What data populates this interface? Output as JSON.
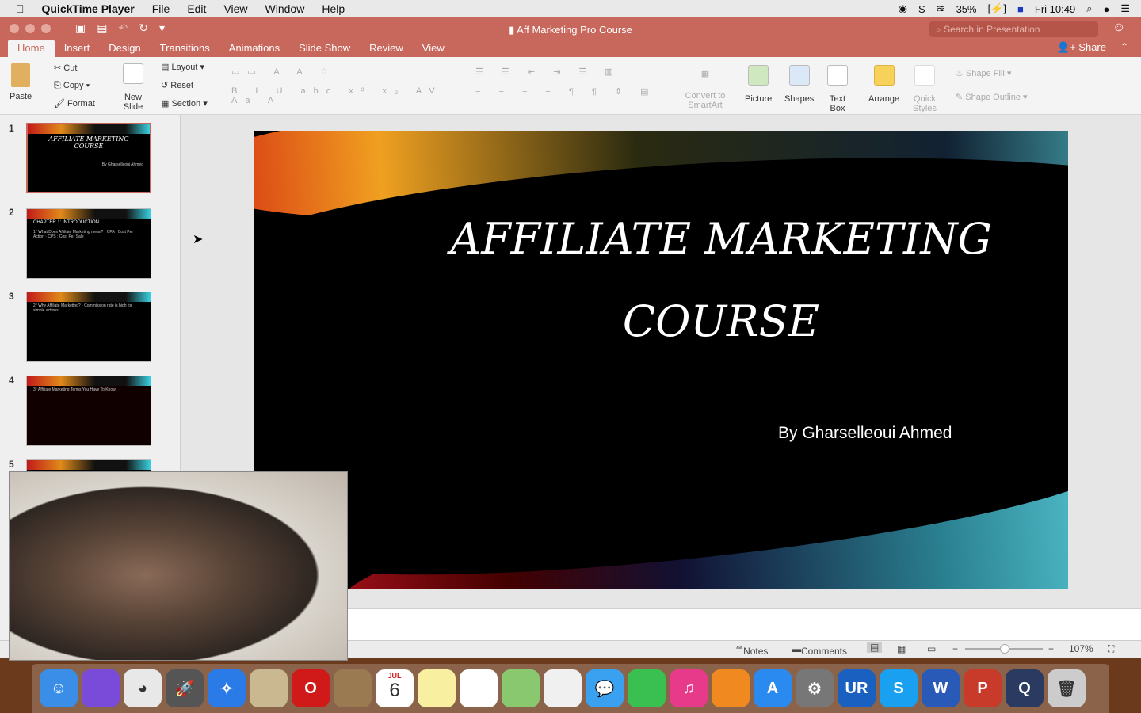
{
  "menubar": {
    "app": "QuickTime Player",
    "items": [
      "File",
      "Edit",
      "View",
      "Window",
      "Help"
    ],
    "battery": "35%",
    "clock": "Fri 10:49"
  },
  "window": {
    "title": "Aff Marketing Pro Course",
    "search_placeholder": "Search in Presentation",
    "share": "Share",
    "tabs": [
      "Home",
      "Insert",
      "Design",
      "Transitions",
      "Animations",
      "Slide Show",
      "Review",
      "View"
    ],
    "active_tab": "Home"
  },
  "ribbon": {
    "paste": "Paste",
    "cut": "Cut",
    "copy": "Copy",
    "format": "Format",
    "new_slide": "New Slide",
    "layout": "Layout",
    "reset": "Reset",
    "section": "Section",
    "convert": "Convert to SmartArt",
    "picture": "Picture",
    "shapes": "Shapes",
    "text_box": "Text Box",
    "arrange": "Arrange",
    "quick_styles": "Quick Styles",
    "shape_fill": "Shape Fill",
    "shape_outline": "Shape Outline"
  },
  "thumbnails": [
    {
      "num": "1",
      "title": "AFFILIATE MARKETING COURSE",
      "sub": "By Gharselleoui Ahmed"
    },
    {
      "num": "2",
      "title": "CHAPTER 1: INTRODUCTION",
      "sub": "1° What Does Affiliate Marketing mean? · CPA : Cost Per Action · CPS : Cost Per Sale"
    },
    {
      "num": "3",
      "title": "",
      "sub": "2° Why Affiliate Marketing? · Commission rate is high for simple actions."
    },
    {
      "num": "4",
      "title": "",
      "sub": "3° Affiliate Marketing Terms You Have To Know"
    },
    {
      "num": "5",
      "title": "",
      "sub": ""
    }
  ],
  "slide": {
    "title_line1": "AFFILIATE MARKETING",
    "title_line2": "COURSE",
    "author": "By Gharselleoui Ahmed"
  },
  "status": {
    "notes": "Notes",
    "comments": "Comments",
    "zoom": "107%",
    "zoom_fraction": 0.5
  },
  "dock": [
    "Finder",
    "Siri",
    "Chrome",
    "Launchpad",
    "Safari",
    "Mail",
    "Opera",
    "Notefile",
    "Calendar",
    "Notes",
    "Reminders",
    "Maps",
    "Photos",
    "Messages",
    "FaceTime",
    "iTunes",
    "iBooks",
    "App Store",
    "System Preferences",
    "UR",
    "Skype",
    "Word",
    "PowerPoint",
    "QuickTime",
    "Trash"
  ],
  "calendar": {
    "month": "JUL",
    "day": "6"
  }
}
